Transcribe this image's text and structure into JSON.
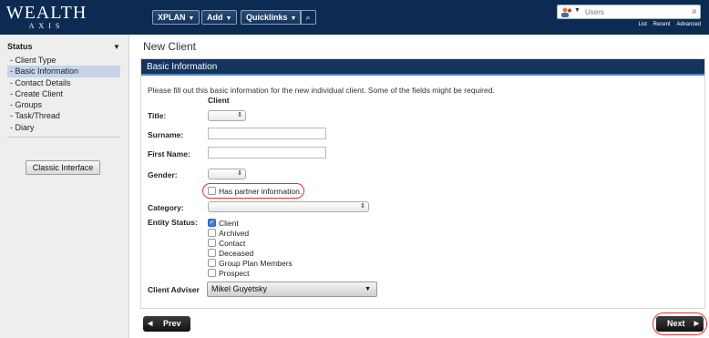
{
  "brand": {
    "logo_top": "WEALTH",
    "logo_bottom": "AXIS"
  },
  "nav": {
    "xplan": "XPLAN",
    "add": "Add",
    "quicklinks": "Quicklinks",
    "quick_search_icon": "search-magnifier-icon"
  },
  "user_search": {
    "placeholder": "Users",
    "links": [
      "List",
      "Recent",
      "Advanced"
    ]
  },
  "sidebar": {
    "heading": "Status",
    "items": [
      {
        "label": "- Client Type",
        "active": false
      },
      {
        "label": "- Basic Information",
        "active": true
      },
      {
        "label": "- Contact Details",
        "active": false
      },
      {
        "label": "- Create Client",
        "active": false
      },
      {
        "label": "- Groups",
        "active": false
      },
      {
        "label": "- Task/Thread",
        "active": false
      },
      {
        "label": "- Diary",
        "active": false
      }
    ],
    "classic_button": "Classic Interface"
  },
  "page": {
    "title": "New Client",
    "panel_title": "Basic Information",
    "intro": "Please fill out this basic information for the new individual client. Some of the fields might be required.",
    "column_header": "Client"
  },
  "form": {
    "title_label": "Title:",
    "surname_label": "Surname:",
    "first_name_label": "First Name:",
    "gender_label": "Gender:",
    "partner_label": "Has partner information.",
    "partner_checked": false,
    "category_label": "Category:",
    "entity_status_label": "Entity Status:",
    "entity_status": [
      {
        "label": "Client",
        "checked": true
      },
      {
        "label": "Archived",
        "checked": false
      },
      {
        "label": "Contact",
        "checked": false
      },
      {
        "label": "Deceased",
        "checked": false
      },
      {
        "label": "Group Plan Members",
        "checked": false
      },
      {
        "label": "Prospect",
        "checked": false
      }
    ],
    "adviser_label": "Client Adviser",
    "adviser_value": "Mikel Guyetsky"
  },
  "buttons": {
    "prev": "Prev",
    "next": "Next"
  },
  "colors": {
    "topbar": "#0d2b52",
    "panel_header": "#11355f",
    "highlight": "#e03030",
    "active_nav": "#c6d4e6"
  }
}
